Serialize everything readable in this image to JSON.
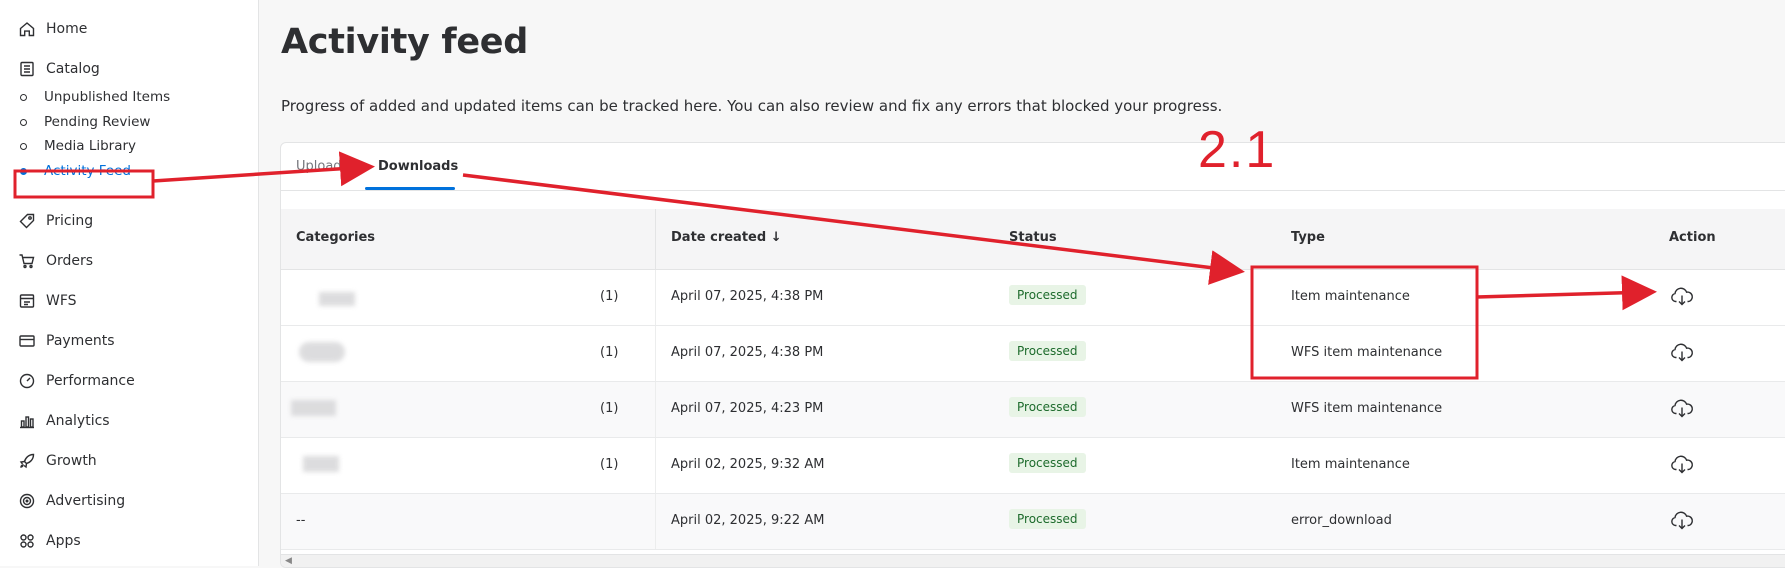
{
  "sidebar": {
    "items": [
      {
        "label": "Home",
        "icon": "home-icon"
      },
      {
        "label": "Catalog",
        "icon": "catalog-icon"
      },
      {
        "label": "Pricing",
        "icon": "price-tag-icon"
      },
      {
        "label": "Orders",
        "icon": "cart-icon"
      },
      {
        "label": "WFS",
        "icon": "wfs-icon"
      },
      {
        "label": "Payments",
        "icon": "credit-card-icon"
      },
      {
        "label": "Performance",
        "icon": "gauge-icon"
      },
      {
        "label": "Analytics",
        "icon": "bar-chart-icon"
      },
      {
        "label": "Growth",
        "icon": "rocket-icon"
      },
      {
        "label": "Advertising",
        "icon": "target-icon"
      },
      {
        "label": "Apps",
        "icon": "apps-grid-icon"
      }
    ],
    "catalog_subitems": [
      {
        "label": "Unpublished Items",
        "active": false
      },
      {
        "label": "Pending Review",
        "active": false
      },
      {
        "label": "Media Library",
        "active": false
      },
      {
        "label": "Activity Feed",
        "active": true
      }
    ]
  },
  "page": {
    "title": "Activity feed",
    "subtitle": "Progress of added and updated items can be tracked here. You can also review and fix any errors that blocked your progress."
  },
  "tabs": [
    {
      "label": "Uploads",
      "active": false
    },
    {
      "label": "Downloads",
      "active": true
    }
  ],
  "table": {
    "columns": [
      "Categories",
      "Date created ↓",
      "Status",
      "Type",
      "Action"
    ],
    "rows": [
      {
        "category": "",
        "count": "(1)",
        "date": "April 07, 2025, 4:38 PM",
        "status": "Processed",
        "type": "Item maintenance"
      },
      {
        "category": "",
        "count": "(1)",
        "date": "April 07, 2025, 4:38 PM",
        "status": "Processed",
        "type": "WFS item maintenance"
      },
      {
        "category": "",
        "count": "(1)",
        "date": "April 07, 2025, 4:23 PM",
        "status": "Processed",
        "type": "WFS item maintenance"
      },
      {
        "category": "",
        "count": "(1)",
        "date": "April 02, 2025, 9:32 AM",
        "status": "Processed",
        "type": "Item maintenance"
      },
      {
        "category": "--",
        "count": "",
        "date": "April 02, 2025, 9:22 AM",
        "status": "Processed",
        "type": "error_download"
      }
    ],
    "action_icon": "cloud-download-icon"
  },
  "annotation": {
    "label": "2.1",
    "color": "#e0212c"
  },
  "colors": {
    "accent": "#0071dc",
    "processed_badge_bg": "#e8f4e6",
    "processed_badge_text": "#1d6b2c",
    "annotation_red": "#e0212c"
  }
}
